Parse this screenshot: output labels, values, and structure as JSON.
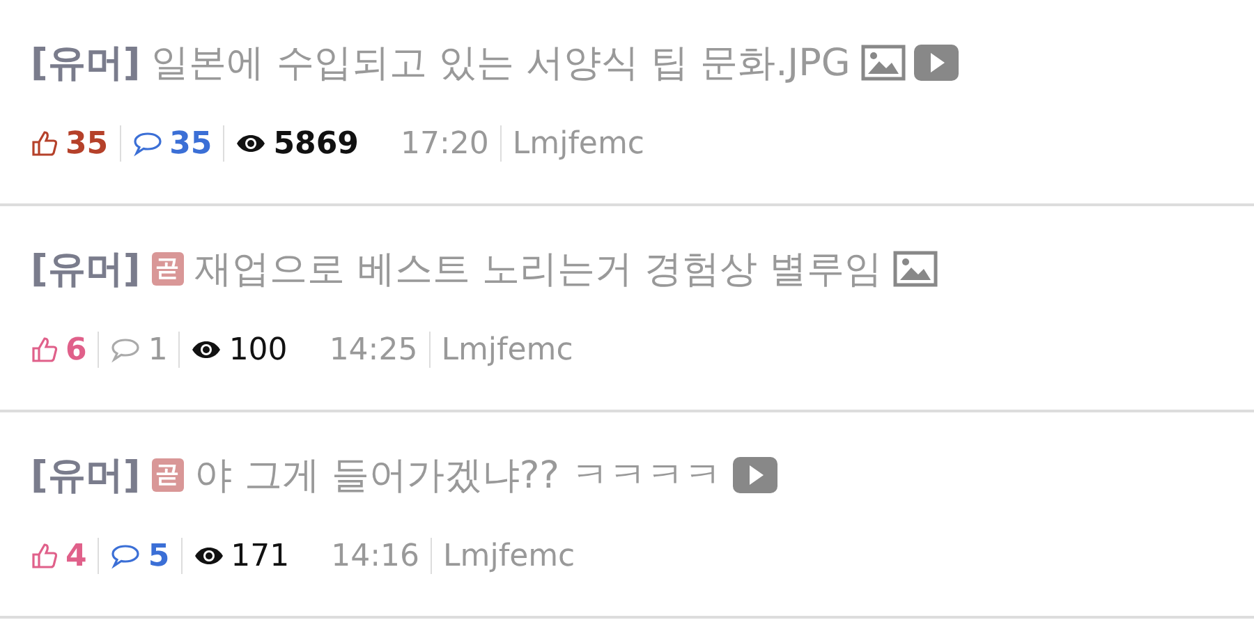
{
  "posts": [
    {
      "category": "[유머]",
      "title": "일본에 수입되고 있는 서양식 팁 문화.JPG",
      "attachments": [
        {
          "kind": "image"
        },
        {
          "kind": "video"
        }
      ],
      "likes": {
        "count": "35",
        "color": "#b5412a"
      },
      "comments": {
        "count": "35",
        "highlighted": true
      },
      "views": {
        "count": "5869",
        "bold": true
      },
      "time": "17:20",
      "author": "Lmjfemc"
    },
    {
      "category": "[유머]",
      "badge": "곧",
      "title": "재업으로 베스트 노리는거 경험상 별루임",
      "attachments": [
        {
          "kind": "image"
        }
      ],
      "likes": {
        "count": "6",
        "color": "#e0608a"
      },
      "comments": {
        "count": "1",
        "highlighted": false
      },
      "views": {
        "count": "100",
        "bold": false
      },
      "time": "14:25",
      "author": "Lmjfemc"
    },
    {
      "category": "[유머]",
      "badge": "곧",
      "title": "야 그게 들어가겠냐?? ㅋㅋㅋㅋ",
      "attachments": [
        {
          "kind": "video"
        }
      ],
      "likes": {
        "count": "4",
        "color": "#e0608a"
      },
      "comments": {
        "count": "5",
        "highlighted": true
      },
      "views": {
        "count": "171",
        "bold": false
      },
      "time": "14:16",
      "author": "Lmjfemc"
    }
  ]
}
